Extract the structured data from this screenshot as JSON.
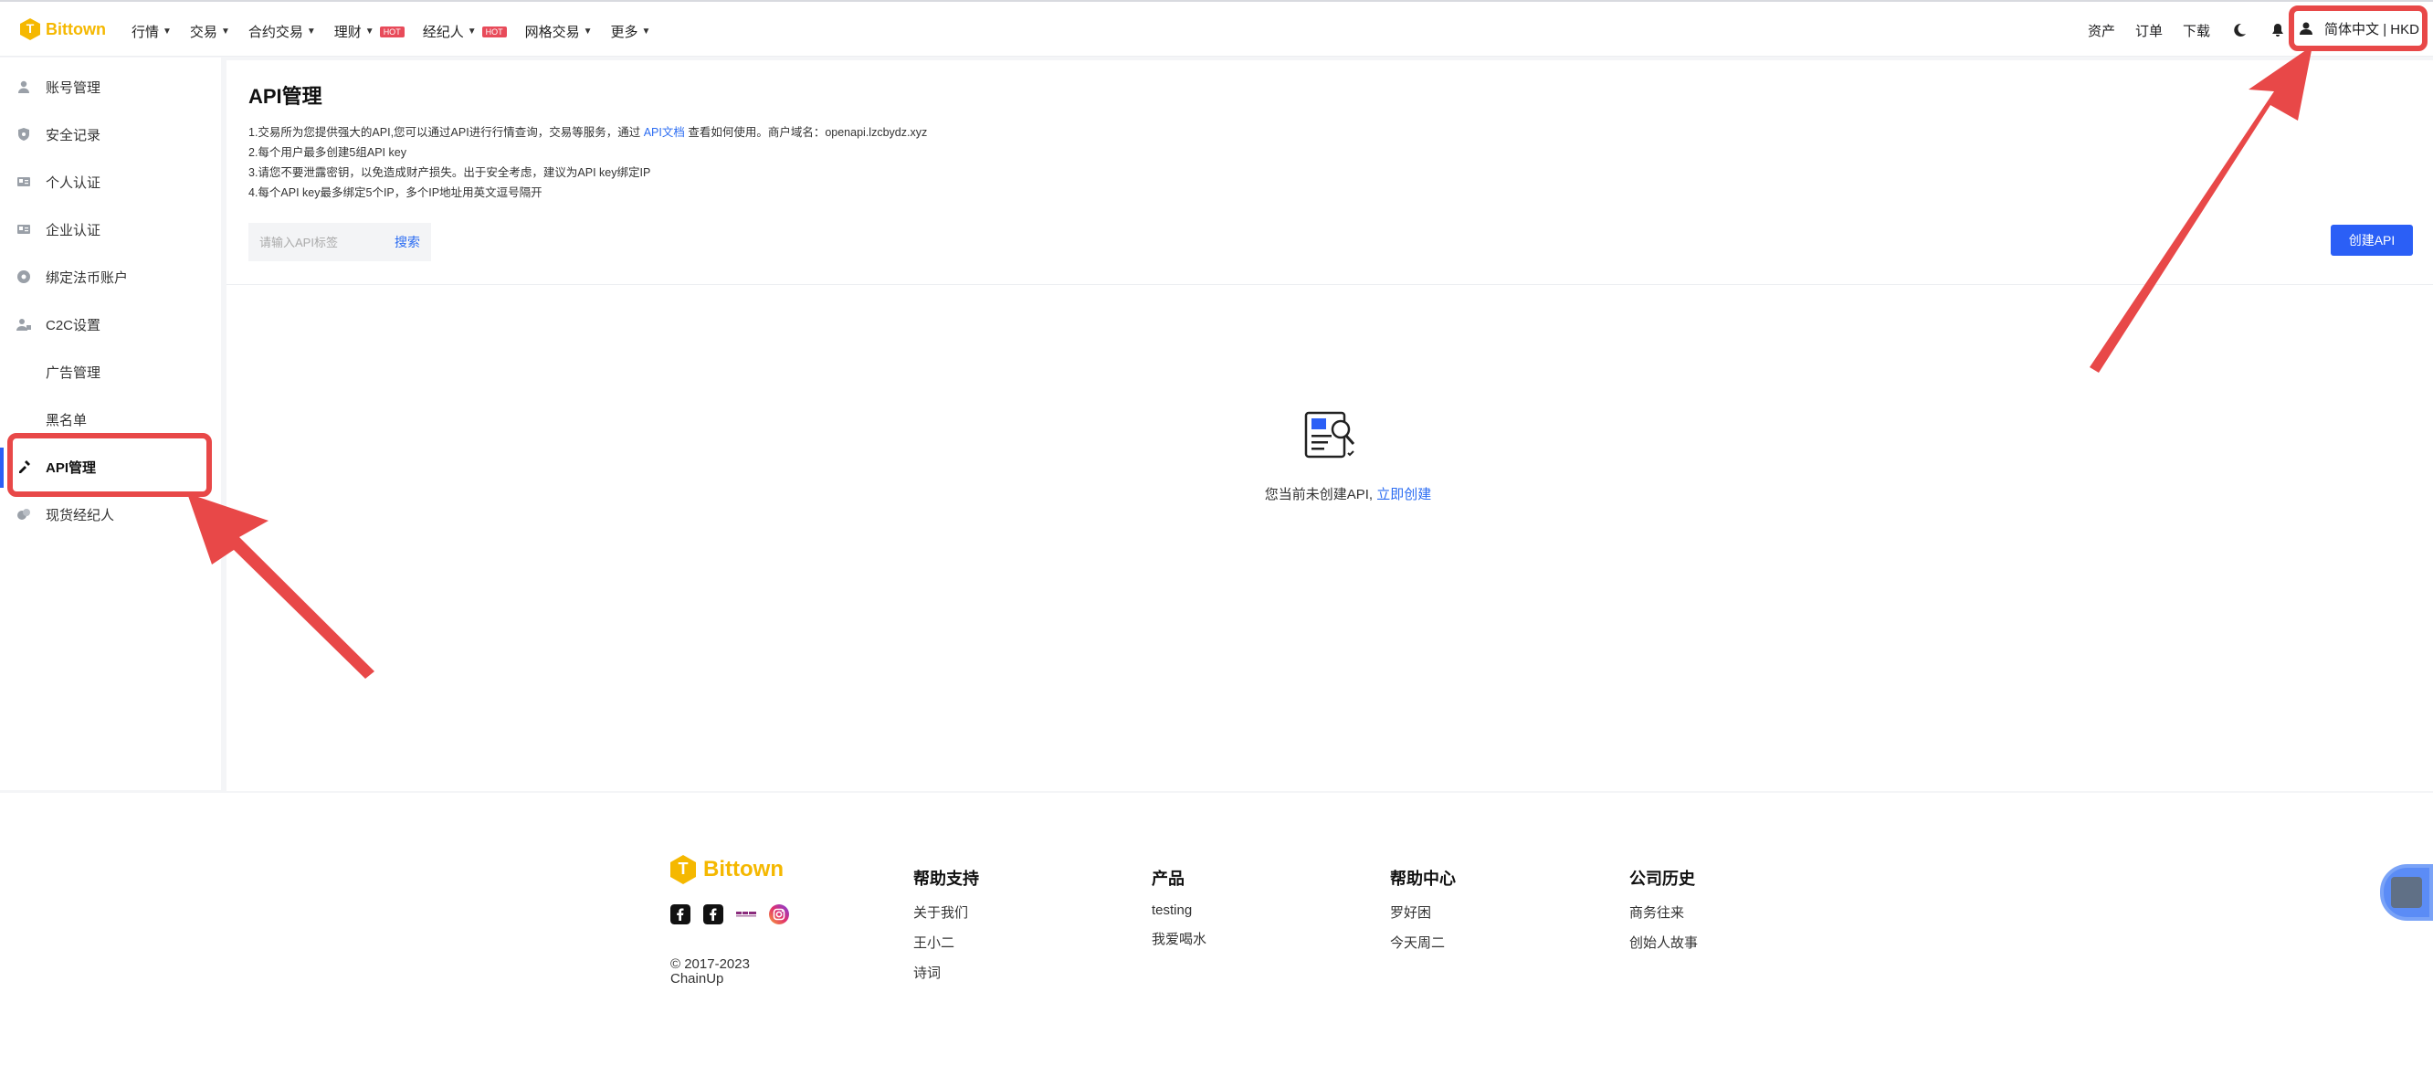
{
  "header": {
    "logo_text": "Bittown",
    "nav": [
      {
        "label": "行情",
        "caret": true,
        "hot": false
      },
      {
        "label": "交易",
        "caret": true,
        "hot": false
      },
      {
        "label": "合约交易",
        "caret": true,
        "hot": false
      },
      {
        "label": "理财",
        "caret": true,
        "hot": true
      },
      {
        "label": "经纪人",
        "caret": true,
        "hot": true
      },
      {
        "label": "网格交易",
        "caret": true,
        "hot": false
      },
      {
        "label": "更多",
        "caret": true,
        "hot": false
      }
    ],
    "hot_label": "HOT",
    "assets": "资产",
    "orders": "订单",
    "download": "下载",
    "language": "简体中文 | HKD"
  },
  "sidebar": {
    "items": [
      {
        "label": "账号管理",
        "icon": "user-icon"
      },
      {
        "label": "安全记录",
        "icon": "shield-icon"
      },
      {
        "label": "个人认证",
        "icon": "id-card-icon"
      },
      {
        "label": "企业认证",
        "icon": "id-card-icon"
      },
      {
        "label": "绑定法币账户",
        "icon": "bank-icon"
      },
      {
        "label": "C2C设置",
        "icon": "users-icon"
      },
      {
        "label": "广告管理",
        "icon": ""
      },
      {
        "label": "黑名单",
        "icon": ""
      },
      {
        "label": "API管理",
        "icon": "key-icon"
      },
      {
        "label": "现货经纪人",
        "icon": "broker-icon"
      }
    ],
    "active_index": 8
  },
  "main": {
    "title": "API管理",
    "notes": {
      "line1_pre": "1.交易所为您提供强大的API,您可以通过API进行行情查询，交易等服务，通过",
      "line1_link": "API文档",
      "line1_post": "查看如何使用。商户域名：openapi.lzcbydz.xyz",
      "line2": "2.每个用户最多创建5组API key",
      "line3": "3.请您不要泄露密钥，以免造成财产损失。出于安全考虑，建议为API key绑定IP",
      "line4": "4.每个API key最多绑定5个IP，多个IP地址用英文逗号隔开"
    },
    "search_placeholder": "请输入API标签",
    "search_button": "搜索",
    "create_button": "创建API",
    "empty_text": "您当前未创建API,",
    "empty_link": "立即创建"
  },
  "footer": {
    "logo_text": "Bittown",
    "copyright_line1": "© 2017-2023",
    "copyright_line2": "ChainUp",
    "columns": [
      {
        "title": "帮助支持",
        "items": [
          "关于我们",
          "王小二",
          "诗词"
        ]
      },
      {
        "title": "产品",
        "items": [
          "testing",
          "我爱喝水"
        ]
      },
      {
        "title": "帮助中心",
        "items": [
          "罗好困",
          "今天周二"
        ]
      },
      {
        "title": "公司历史",
        "items": [
          "商务往来",
          "创始人故事"
        ]
      }
    ]
  },
  "colors": {
    "brand": "#f5b800",
    "accent": "#2b5ff6",
    "highlight": "#e84848"
  }
}
